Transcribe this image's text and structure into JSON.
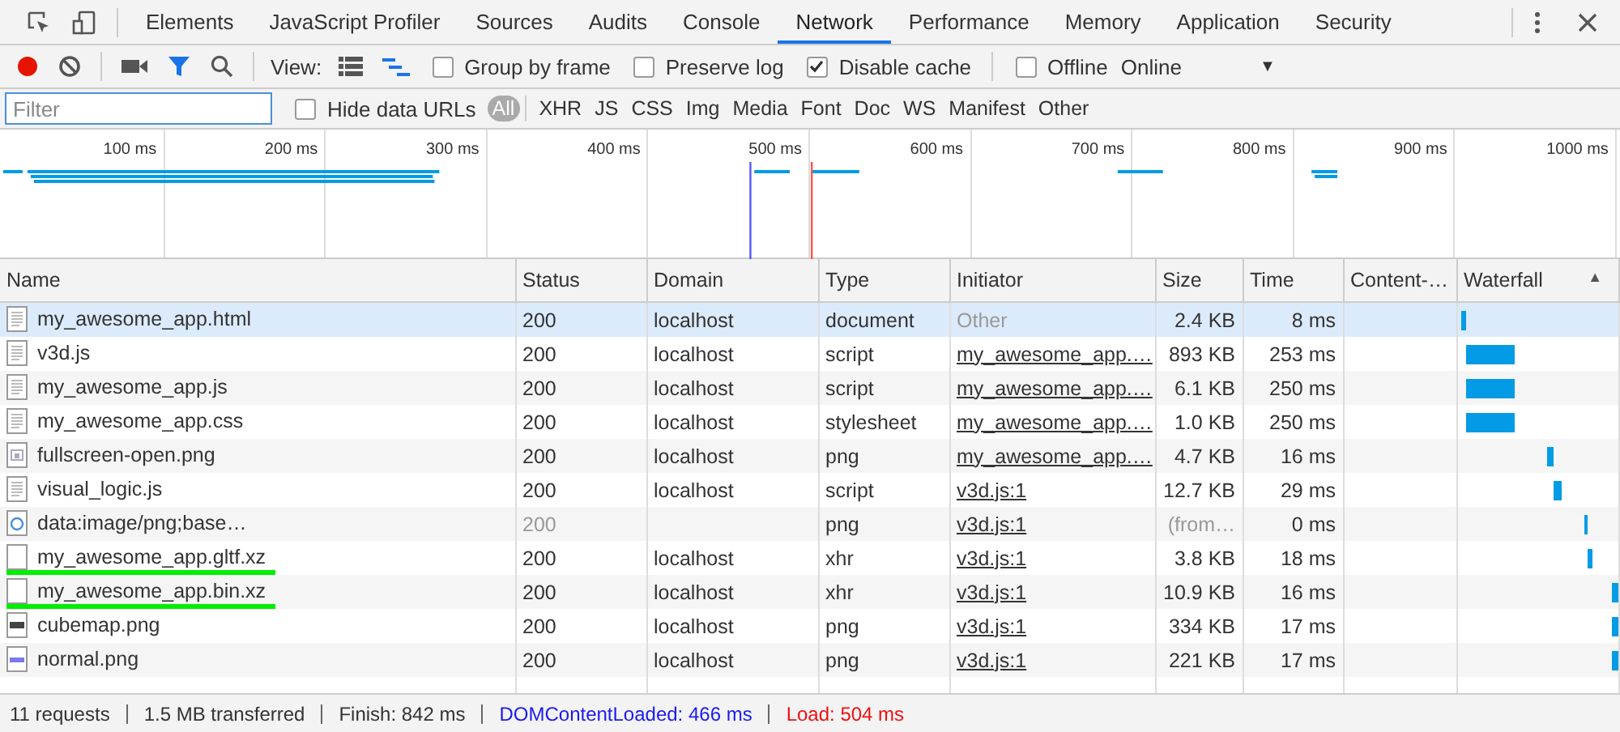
{
  "tabs": [
    {
      "label": "Elements",
      "selected": false
    },
    {
      "label": "JavaScript Profiler",
      "selected": false
    },
    {
      "label": "Sources",
      "selected": false
    },
    {
      "label": "Audits",
      "selected": false
    },
    {
      "label": "Console",
      "selected": false
    },
    {
      "label": "Network",
      "selected": true
    },
    {
      "label": "Performance",
      "selected": false
    },
    {
      "label": "Memory",
      "selected": false
    },
    {
      "label": "Application",
      "selected": false
    },
    {
      "label": "Security",
      "selected": false
    }
  ],
  "toolbar": {
    "recording": true,
    "filter_active": true,
    "view_label": "View:",
    "views": [
      {
        "kind": "list",
        "selected": false
      },
      {
        "kind": "waterfall",
        "selected": true
      }
    ],
    "options": [
      {
        "label": "Group by frame",
        "checked": false
      },
      {
        "label": "Preserve log",
        "checked": false
      },
      {
        "label": "Disable cache",
        "checked": true
      }
    ],
    "offline": {
      "label": "Offline",
      "checked": false
    },
    "throttling": "Online",
    "dropdown_arrow": "▼"
  },
  "filter": {
    "placeholder": "Filter",
    "hide_data_urls": {
      "label": "Hide data URLs",
      "checked": false
    },
    "types": [
      {
        "label": "All",
        "selected": true
      },
      {
        "label": "XHR",
        "selected": false
      },
      {
        "label": "JS",
        "selected": false
      },
      {
        "label": "CSS",
        "selected": false
      },
      {
        "label": "Img",
        "selected": false
      },
      {
        "label": "Media",
        "selected": false
      },
      {
        "label": "Font",
        "selected": false
      },
      {
        "label": "Doc",
        "selected": false
      },
      {
        "label": "WS",
        "selected": false
      },
      {
        "label": "Manifest",
        "selected": false
      },
      {
        "label": "Other",
        "selected": false
      }
    ]
  },
  "overview": {
    "ticks": [
      "100 ms",
      "200 ms",
      "300 ms",
      "400 ms",
      "500 ms",
      "600 ms",
      "700 ms",
      "800 ms",
      "900 ms",
      "1000 ms"
    ]
  },
  "table": {
    "columns": [
      "Name",
      "Status",
      "Domain",
      "Type",
      "Initiator",
      "Size",
      "Time",
      "Content-…",
      "Waterfall"
    ],
    "sort_arrow": "▲",
    "rows": [
      {
        "kind": "document",
        "name": "my_awesome_app.html",
        "status": "200",
        "domain": "localhost",
        "type": "document",
        "initiator": "Other",
        "initiator_link": false,
        "size": "2.4 KB",
        "time": "8 ms",
        "selected": true,
        "dimmed": false,
        "underlined": false
      },
      {
        "kind": "document",
        "name": "v3d.js",
        "status": "200",
        "domain": "localhost",
        "type": "script",
        "initiator": "my_awesome_app.…",
        "initiator_link": true,
        "size": "893 KB",
        "time": "253 ms",
        "selected": false,
        "dimmed": false,
        "underlined": false
      },
      {
        "kind": "document",
        "name": "my_awesome_app.js",
        "status": "200",
        "domain": "localhost",
        "type": "script",
        "initiator": "my_awesome_app.…",
        "initiator_link": true,
        "size": "6.1 KB",
        "time": "250 ms",
        "selected": false,
        "dimmed": false,
        "underlined": false
      },
      {
        "kind": "document",
        "name": "my_awesome_app.css",
        "status": "200",
        "domain": "localhost",
        "type": "stylesheet",
        "initiator": "my_awesome_app.…",
        "initiator_link": true,
        "size": "1.0 KB",
        "time": "250 ms",
        "selected": false,
        "dimmed": false,
        "underlined": false
      },
      {
        "kind": "image",
        "name": "fullscreen-open.png",
        "status": "200",
        "domain": "localhost",
        "type": "png",
        "initiator": "my_awesome_app.…",
        "initiator_link": true,
        "size": "4.7 KB",
        "time": "16 ms",
        "selected": false,
        "dimmed": false,
        "underlined": false
      },
      {
        "kind": "document",
        "name": "visual_logic.js",
        "status": "200",
        "domain": "localhost",
        "type": "script",
        "initiator": "v3d.js:1",
        "initiator_link": true,
        "size": "12.7 KB",
        "time": "29 ms",
        "selected": false,
        "dimmed": false,
        "underlined": false
      },
      {
        "kind": "data",
        "name": "data:image/png;base…",
        "status": "200",
        "type": "png",
        "initiator": "v3d.js:1",
        "initiator_link": true,
        "size": "(from…",
        "time": "0 ms",
        "selected": false,
        "dimmed": true,
        "underlined": false
      },
      {
        "kind": "blank",
        "name": "my_awesome_app.gltf.xz",
        "status": "200",
        "domain": "localhost",
        "type": "xhr",
        "initiator": "v3d.js:1",
        "initiator_link": true,
        "size": "3.8 KB",
        "time": "18 ms",
        "selected": false,
        "dimmed": false,
        "underlined": true
      },
      {
        "kind": "blank",
        "name": "my_awesome_app.bin.xz",
        "status": "200",
        "domain": "localhost",
        "type": "xhr",
        "initiator": "v3d.js:1",
        "initiator_link": true,
        "size": "10.9 KB",
        "time": "16 ms",
        "selected": false,
        "dimmed": false,
        "underlined": true
      },
      {
        "kind": "photo",
        "name": "cubemap.png",
        "status": "200",
        "domain": "localhost",
        "type": "png",
        "initiator": "v3d.js:1",
        "initiator_link": true,
        "size": "334 KB",
        "time": "17 ms",
        "selected": false,
        "dimmed": false,
        "underlined": false
      },
      {
        "kind": "swatch",
        "name": "normal.png",
        "status": "200",
        "domain": "localhost",
        "type": "png",
        "initiator": "v3d.js:1",
        "initiator_link": true,
        "size": "221 KB",
        "time": "17 ms",
        "selected": false,
        "dimmed": false,
        "underlined": false
      }
    ]
  },
  "status_bar": [
    {
      "kind": "plain",
      "text": "11 requests"
    },
    {
      "kind": "plain",
      "text": "1.5 MB transferred"
    },
    {
      "kind": "plain",
      "text": "Finish: 842 ms"
    },
    {
      "kind": "dom",
      "text": "DOMContentLoaded: 466 ms"
    },
    {
      "kind": "load",
      "text": "Load: 504 ms"
    }
  ]
}
